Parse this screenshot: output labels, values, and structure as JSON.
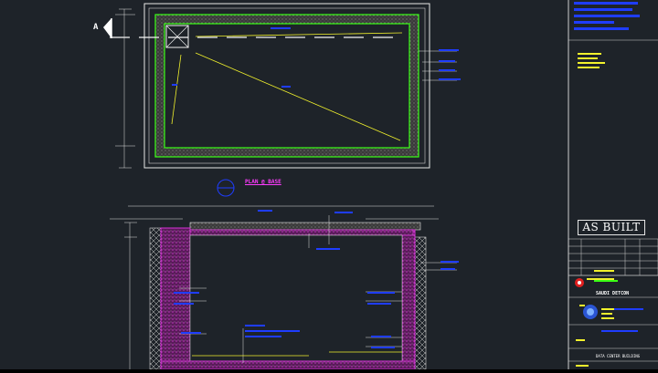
{
  "drawing": {
    "section_marker": "A",
    "plan_title": "PLAN @ BASE",
    "stamp": "AS BUILT",
    "company": "SAUDI DETCON",
    "project": "DATA CENTER BUILDING"
  },
  "colors": {
    "background": "#1e2329",
    "tank_outline": "#e8e8e8",
    "lining": "#39ff14",
    "section_wall": "#d633d6",
    "leader": "#f2f22c",
    "callout": "#1f3dff",
    "title_text": "#ff3bff",
    "annotation": "#ffffff"
  },
  "icons": [
    "section-arrow-icon",
    "drain-box-icon",
    "company-logo-icon",
    "section-marker-icon"
  ]
}
